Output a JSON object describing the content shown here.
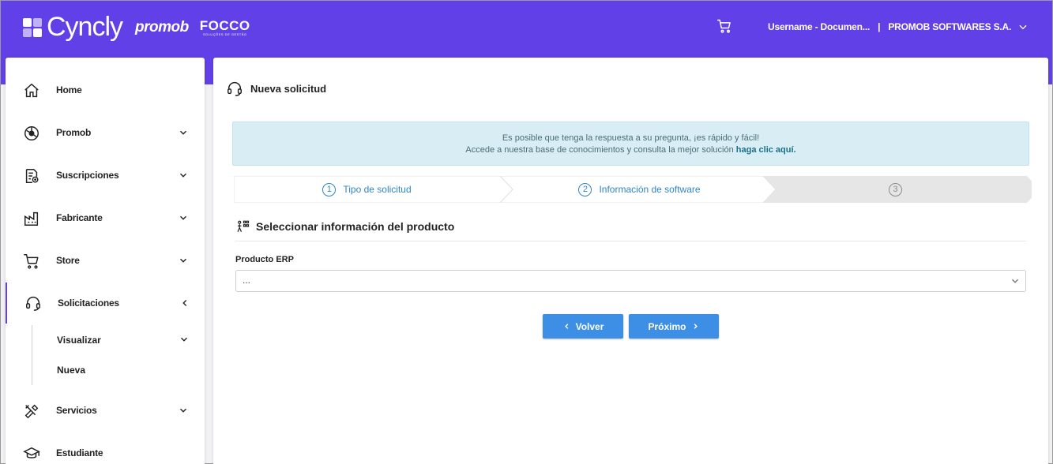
{
  "header": {
    "brand": "Cyncly",
    "partner1": "promob",
    "partner2": "FOCCO",
    "partner2_tagline": "SOLUÇÕES DE GESTÃO",
    "username": "Username - Documen...",
    "separator": "|",
    "company": "PROMOB SOFTWARES S.A.",
    "accent_color": "#6240e8"
  },
  "sidebar": {
    "items": [
      {
        "label": "Home",
        "icon": "home-icon"
      },
      {
        "label": "Promob",
        "icon": "promob-icon"
      },
      {
        "label": "Suscripciones",
        "icon": "subscription-icon"
      },
      {
        "label": "Fabricante",
        "icon": "factory-icon"
      },
      {
        "label": "Store",
        "icon": "cart-icon"
      },
      {
        "label": "Solicitaciones",
        "icon": "headset-icon"
      },
      {
        "label": "Servicios",
        "icon": "tools-icon"
      },
      {
        "label": "Estudiante",
        "icon": "graduation-cap-icon"
      }
    ],
    "subitems": [
      {
        "label": "Visualizar"
      },
      {
        "label": "Nueva"
      }
    ]
  },
  "main": {
    "title": "Nueva solicitud",
    "alert": {
      "line1": "Es posible que tenga la respuesta a su pregunta, ¡es rápido y fácil!",
      "line2_prefix": "Accede a nuestra base de conocimientos y consulta la mejor solución ",
      "link": "haga clic aquí."
    },
    "steps": [
      {
        "num": "1",
        "label": "Tipo de solicitud"
      },
      {
        "num": "2",
        "label": "Información de software"
      },
      {
        "num": "3",
        "label": ""
      }
    ],
    "section_title": "Seleccionar información del producto",
    "field_label": "Producto ERP",
    "select_value": "...",
    "buttons": {
      "back": "Volver",
      "next": "Próximo"
    }
  }
}
